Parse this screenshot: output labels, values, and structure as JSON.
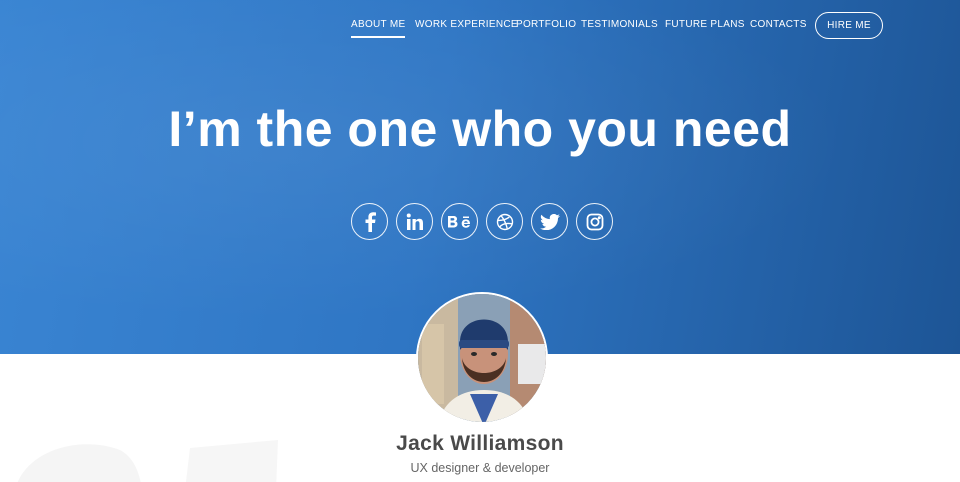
{
  "nav": {
    "items": [
      {
        "label": "ABOUT ME",
        "active": true
      },
      {
        "label": "WORK EXPERIENCE",
        "active": false
      },
      {
        "label": "PORTFOLIO",
        "active": false
      },
      {
        "label": "TESTIMONIALS",
        "active": false
      },
      {
        "label": "FUTURE PLANS",
        "active": false
      },
      {
        "label": "CONTACTS",
        "active": false
      }
    ],
    "hire_label": "HIRE ME"
  },
  "hero": {
    "headline": "I’m the one who you need",
    "socials": [
      "facebook-icon",
      "linkedin-icon",
      "behance-icon",
      "dribbble-icon",
      "twitter-icon",
      "instagram-icon"
    ]
  },
  "profile": {
    "name": "Jack Williamson",
    "role": "UX designer & developer"
  },
  "colors": {
    "hero_start": "#3a85d3",
    "hero_end": "#1d5596",
    "text_dark": "#4a4a4a",
    "text_muted": "#666666"
  }
}
